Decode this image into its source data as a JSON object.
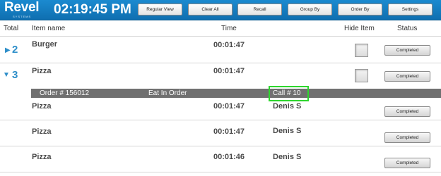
{
  "header": {
    "logo_text": "Revel",
    "logo_subtext": "SYSTEMS",
    "clock": "02:19:45 PM",
    "buttons": [
      "Regular View",
      "Clear All",
      "Recall",
      "Group By",
      "Order By",
      "Settings"
    ]
  },
  "columns": {
    "total": "Total",
    "item_name": "Item name",
    "time": "Time",
    "hide_item": "Hide Item",
    "status": "Status"
  },
  "groups": [
    {
      "total": "2",
      "expanded": false,
      "name": "Burger",
      "time": "00:01:47",
      "status": "Completed"
    },
    {
      "total": "3",
      "expanded": true,
      "name": "Pizza",
      "time": "00:01:47",
      "status": "Completed"
    }
  ],
  "order": {
    "number": "Order # 156012",
    "type": "Eat In Order",
    "call": "Call # 10"
  },
  "items": [
    {
      "name": "Pizza",
      "time": "00:01:47",
      "user": "Denis S",
      "status": "Completed"
    },
    {
      "name": "Pizza",
      "time": "00:01:47",
      "user": "Denis S",
      "status": "Completed"
    },
    {
      "name": "Pizza",
      "time": "00:01:46",
      "user": "Denis S",
      "status": "Completed"
    }
  ],
  "colors": {
    "topbar": "#1477bd",
    "accent": "#2d8ec9",
    "order_bar": "#707070",
    "highlight": "#2ed62e"
  },
  "icons": {
    "collapsed": "triangle-right-icon",
    "expanded": "triangle-down-icon"
  }
}
